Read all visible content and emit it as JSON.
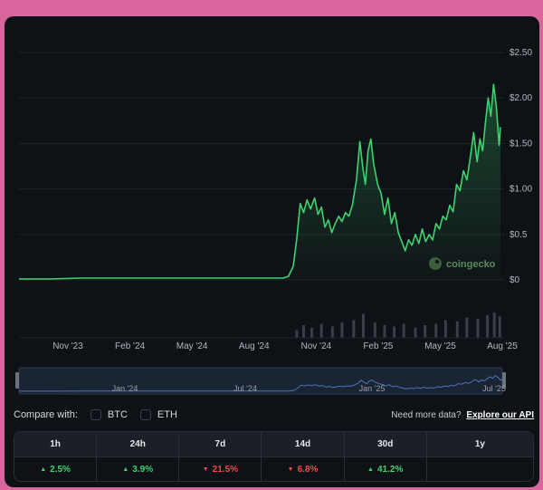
{
  "chart_data": {
    "type": "area",
    "y_ticks": [
      "$2.50",
      "$2.00",
      "$1.50",
      "$1.00",
      "$0.5",
      "$0"
    ],
    "y_tick_values": [
      2.5,
      2.0,
      1.5,
      1.0,
      0.5,
      0
    ],
    "ylim": [
      0,
      2.5
    ],
    "x_ticks": [
      "Nov '23",
      "Feb '24",
      "May '24",
      "Aug '24",
      "Nov '24",
      "Feb '25",
      "May '25",
      "Aug '25"
    ],
    "navigator_ticks": [
      "Jan '24",
      "Jul '24",
      "Jan '25",
      "Jul '25"
    ],
    "x_start": "2023-09-01",
    "x_end": "2025-08-03",
    "series": [
      {
        "color": "#3fd26f",
        "points": [
          [
            "2023-09-01",
            0.01
          ],
          [
            "2023-10-15",
            0.01
          ],
          [
            "2023-12-01",
            0.02
          ],
          [
            "2024-01-15",
            0.02
          ],
          [
            "2024-03-01",
            0.02
          ],
          [
            "2024-04-15",
            0.02
          ],
          [
            "2024-06-01",
            0.02
          ],
          [
            "2024-07-15",
            0.02
          ],
          [
            "2024-09-01",
            0.02
          ],
          [
            "2024-09-20",
            0.02
          ],
          [
            "2024-09-28",
            0.04
          ],
          [
            "2024-10-05",
            0.15
          ],
          [
            "2024-10-10",
            0.45
          ],
          [
            "2024-10-15",
            0.84
          ],
          [
            "2024-10-20",
            0.74
          ],
          [
            "2024-10-25",
            0.88
          ],
          [
            "2024-10-30",
            0.78
          ],
          [
            "2024-11-05",
            0.9
          ],
          [
            "2024-11-10",
            0.72
          ],
          [
            "2024-11-15",
            0.8
          ],
          [
            "2024-11-20",
            0.58
          ],
          [
            "2024-11-25",
            0.66
          ],
          [
            "2024-11-30",
            0.52
          ],
          [
            "2024-12-05",
            0.62
          ],
          [
            "2024-12-10",
            0.7
          ],
          [
            "2024-12-15",
            0.64
          ],
          [
            "2024-12-20",
            0.74
          ],
          [
            "2024-12-25",
            0.7
          ],
          [
            "2024-12-30",
            0.82
          ],
          [
            "2025-01-05",
            1.1
          ],
          [
            "2025-01-10",
            1.52
          ],
          [
            "2025-01-14",
            1.25
          ],
          [
            "2025-01-18",
            1.05
          ],
          [
            "2025-01-22",
            1.42
          ],
          [
            "2025-01-26",
            1.55
          ],
          [
            "2025-01-30",
            1.28
          ],
          [
            "2025-02-05",
            1.05
          ],
          [
            "2025-02-10",
            0.95
          ],
          [
            "2025-02-15",
            0.72
          ],
          [
            "2025-02-20",
            0.9
          ],
          [
            "2025-02-25",
            0.62
          ],
          [
            "2025-03-02",
            0.74
          ],
          [
            "2025-03-07",
            0.52
          ],
          [
            "2025-03-12",
            0.42
          ],
          [
            "2025-03-17",
            0.32
          ],
          [
            "2025-03-22",
            0.44
          ],
          [
            "2025-03-27",
            0.38
          ],
          [
            "2025-04-01",
            0.5
          ],
          [
            "2025-04-06",
            0.4
          ],
          [
            "2025-04-11",
            0.56
          ],
          [
            "2025-04-16",
            0.42
          ],
          [
            "2025-04-21",
            0.5
          ],
          [
            "2025-04-26",
            0.44
          ],
          [
            "2025-05-01",
            0.62
          ],
          [
            "2025-05-06",
            0.56
          ],
          [
            "2025-05-11",
            0.7
          ],
          [
            "2025-05-16",
            0.66
          ],
          [
            "2025-05-21",
            0.82
          ],
          [
            "2025-05-26",
            0.75
          ],
          [
            "2025-05-31",
            1.05
          ],
          [
            "2025-06-05",
            0.98
          ],
          [
            "2025-06-10",
            1.2
          ],
          [
            "2025-06-15",
            1.1
          ],
          [
            "2025-06-20",
            1.35
          ],
          [
            "2025-06-25",
            1.62
          ],
          [
            "2025-06-30",
            1.3
          ],
          [
            "2025-07-04",
            1.55
          ],
          [
            "2025-07-08",
            1.42
          ],
          [
            "2025-07-12",
            1.72
          ],
          [
            "2025-07-16",
            2.0
          ],
          [
            "2025-07-20",
            1.8
          ],
          [
            "2025-07-24",
            2.15
          ],
          [
            "2025-07-28",
            1.9
          ],
          [
            "2025-08-01",
            1.48
          ],
          [
            "2025-08-03",
            1.68
          ]
        ]
      }
    ],
    "volume": [
      [
        "2024-10-10",
        0.3
      ],
      [
        "2024-10-20",
        0.5
      ],
      [
        "2024-11-01",
        0.4
      ],
      [
        "2024-11-15",
        0.55
      ],
      [
        "2024-12-01",
        0.45
      ],
      [
        "2024-12-15",
        0.6
      ],
      [
        "2025-01-01",
        0.7
      ],
      [
        "2025-01-15",
        0.95
      ],
      [
        "2025-02-01",
        0.6
      ],
      [
        "2025-02-15",
        0.5
      ],
      [
        "2025-03-01",
        0.45
      ],
      [
        "2025-03-15",
        0.55
      ],
      [
        "2025-04-01",
        0.4
      ],
      [
        "2025-04-15",
        0.5
      ],
      [
        "2025-05-01",
        0.55
      ],
      [
        "2025-05-15",
        0.7
      ],
      [
        "2025-06-01",
        0.65
      ],
      [
        "2025-06-15",
        0.8
      ],
      [
        "2025-07-01",
        0.75
      ],
      [
        "2025-07-15",
        0.9
      ],
      [
        "2025-07-25",
        1.0
      ],
      [
        "2025-08-02",
        0.85
      ]
    ],
    "watermark": "coingecko",
    "grid": true
  },
  "compare": {
    "label": "Compare with:",
    "options": [
      "BTC",
      "ETH"
    ]
  },
  "api": {
    "prefix": "Need more data?",
    "link": "Explore our API"
  },
  "performance": [
    {
      "period": "1h",
      "value": "2.5%",
      "direction": "up"
    },
    {
      "period": "24h",
      "value": "3.9%",
      "direction": "up"
    },
    {
      "period": "7d",
      "value": "21.5%",
      "direction": "down"
    },
    {
      "period": "14d",
      "value": "6.8%",
      "direction": "down"
    },
    {
      "period": "30d",
      "value": "41.2%",
      "direction": "up"
    },
    {
      "period": "1y",
      "value": "",
      "direction": ""
    }
  ],
  "colors": {
    "line": "#3fd26f",
    "up": "#3fd26f",
    "down": "#ef4a4a",
    "navigator_line": "#4a74b8",
    "background": "#0e1116"
  }
}
